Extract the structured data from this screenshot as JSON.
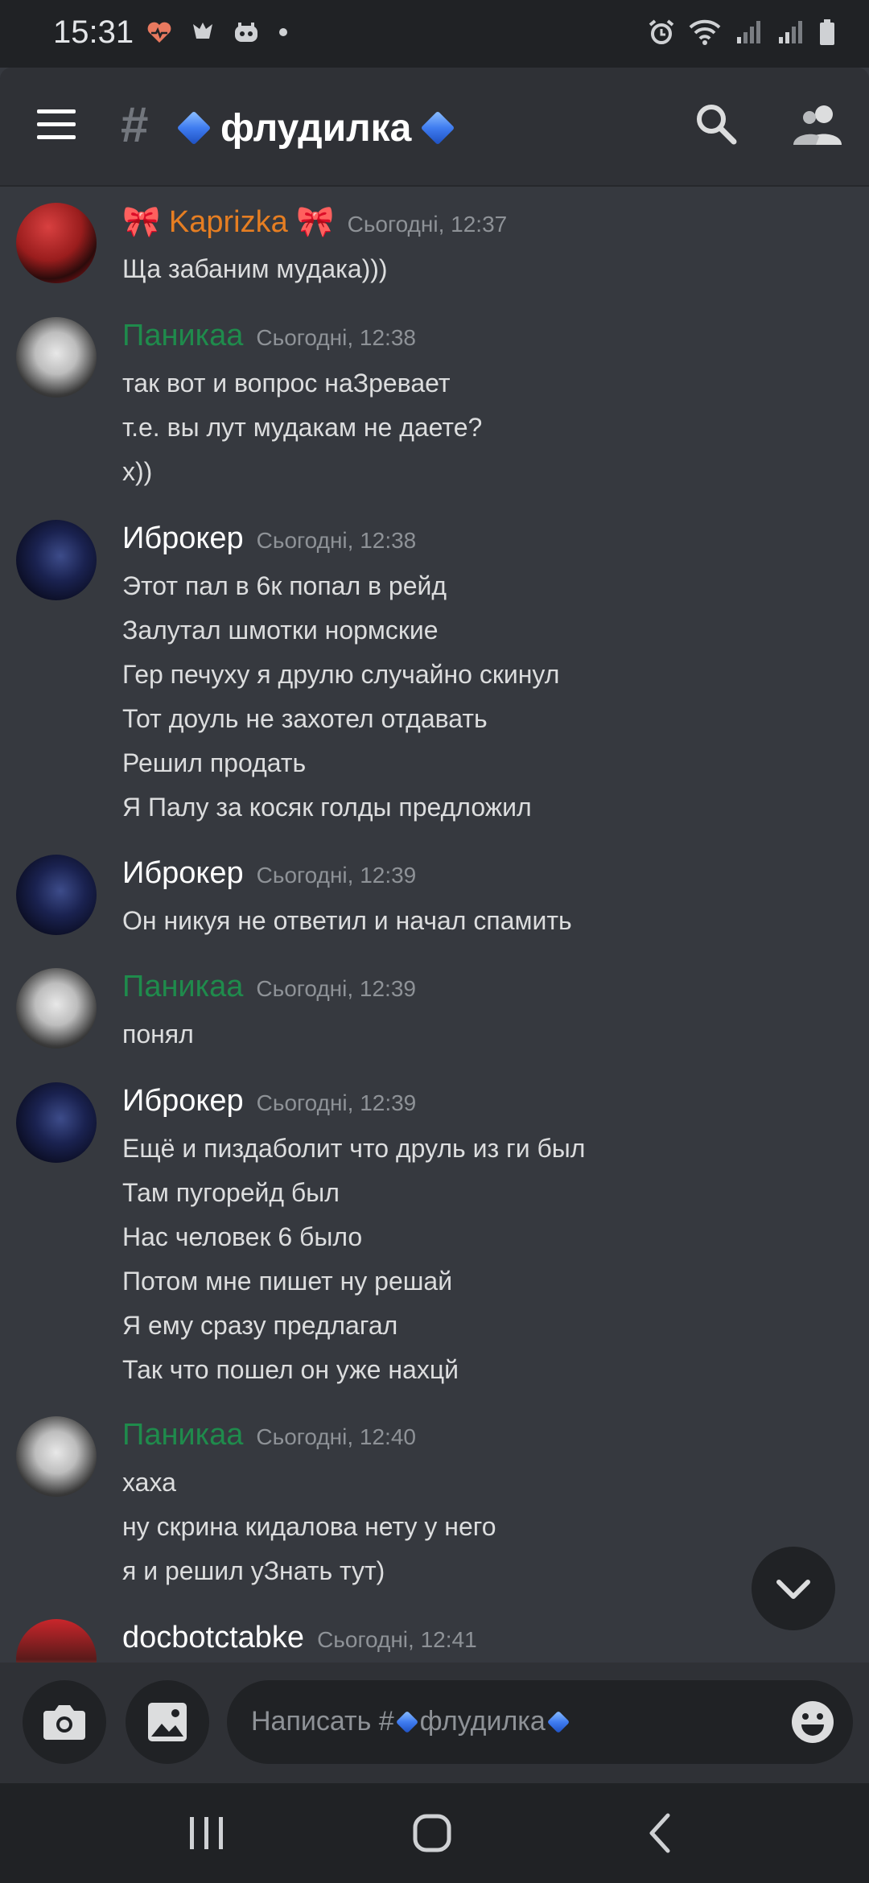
{
  "status_bar": {
    "time": "15:31"
  },
  "header": {
    "hash": "#",
    "channel_name": "флудилка"
  },
  "messages": [
    {
      "author": "Kaprizka",
      "author_prefix": "🎀",
      "author_suffix": "🎀",
      "author_color": "#e67e22",
      "timestamp": "Сьогодні, 12:37",
      "lines": [
        "Ща забаним мудака)))"
      ]
    },
    {
      "author": "Паникаа",
      "author_color": "#1f8b4c",
      "timestamp": "Сьогодні, 12:38",
      "lines": [
        "так вот и вопрос наЗревает",
        "т.е. вы лут мудакам не даете?",
        "x))"
      ]
    },
    {
      "author": "Иброкер",
      "author_color": "#ffffff",
      "timestamp": "Сьогодні, 12:38",
      "lines": [
        "Этот пал в 6к попал в рейд",
        "Залутал шмотки нормские",
        "Гер печуху я друлю случайно скинул",
        "Тот доуль не захотел отдавать",
        "Решил продать",
        "Я Палу за косяк голды предложил"
      ]
    },
    {
      "author": "Иброкер",
      "author_color": "#ffffff",
      "timestamp": "Сьогодні, 12:39",
      "lines": [
        "Он никуя не ответил и начал спамить"
      ]
    },
    {
      "author": "Паникаа",
      "author_color": "#1f8b4c",
      "timestamp": "Сьогодні, 12:39",
      "lines": [
        "понял"
      ]
    },
    {
      "author": "Иброкер",
      "author_color": "#ffffff",
      "timestamp": "Сьогодні, 12:39",
      "lines": [
        "Ещё и пиздаболит что друль из ги был",
        "Там пугорейд был",
        "Нас человек 6 было",
        "Потом мне пишет ну решай",
        "Я ему сразу предлагал",
        "Так что пошел он уже нахцй"
      ]
    },
    {
      "author": "Паникаа",
      "author_color": "#1f8b4c",
      "timestamp": "Сьогодні, 12:40",
      "lines": [
        "хаха",
        "ну скрина кидалова нету у него",
        "я и решил уЗнать тут)"
      ]
    },
    {
      "author": "docbotctabke",
      "author_color": "#ffffff",
      "timestamp": "Сьогодні, 12:41",
      "lines": []
    }
  ],
  "composer": {
    "placeholder_prefix": "Написать #",
    "placeholder_channel": "флудилка"
  },
  "icons": {
    "menu": "hamburger-menu-icon",
    "search": "search-icon",
    "members": "members-icon",
    "camera": "camera-icon",
    "gallery": "image-icon",
    "emoji": "emoji-icon",
    "scroll_down": "chevron-down-icon"
  },
  "colors": {
    "background": "#36393f",
    "header": "#2f3136",
    "dark": "#202225",
    "timestamp": "#8e9297",
    "text": "#dcddde"
  }
}
